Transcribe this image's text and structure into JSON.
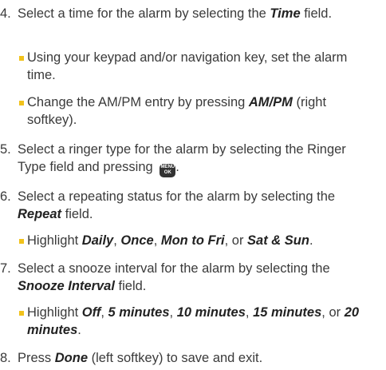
{
  "steps": [
    {
      "num": "4.",
      "parts": [
        "Select a time for the alarm by selecting the ",
        "Time",
        " field."
      ],
      "subs": [
        {
          "parts": [
            "Using your keypad and/or navigation key, set the alarm time."
          ]
        },
        {
          "parts": [
            "Change the AM/PM entry by pressing ",
            "AM/PM",
            " (right softkey)."
          ]
        }
      ]
    },
    {
      "num": "5.",
      "parts": [
        "Select a ringer type for the alarm by selecting the Ringer Type field and pressing ",
        "."
      ]
    },
    {
      "num": "6.",
      "parts": [
        "Select a repeating status for the alarm by selecting the ",
        "Repeat",
        " field."
      ],
      "subs": [
        {
          "parts": [
            "Highlight ",
            "Daily",
            ", ",
            "Once",
            ", ",
            "Mon to Fri",
            ", or ",
            "Sat & Sun",
            "."
          ]
        }
      ]
    },
    {
      "num": "7.",
      "parts": [
        "Select a snooze interval for the alarm by selecting the ",
        "Snooze Interval",
        " field."
      ],
      "subs": [
        {
          "parts": [
            "Highlight ",
            "Off",
            ", ",
            "5 minutes",
            ", ",
            "10 minutes",
            ", ",
            "15 minutes",
            ", or ",
            "20 minutes",
            "."
          ]
        }
      ]
    },
    {
      "num": "8.",
      "parts": [
        "Press ",
        "Done",
        " (left softkey) to save and exit."
      ]
    }
  ],
  "menu_ok_key": {
    "icon": "menu-ok-key-icon",
    "top": "MENU",
    "bottom": "OK"
  }
}
